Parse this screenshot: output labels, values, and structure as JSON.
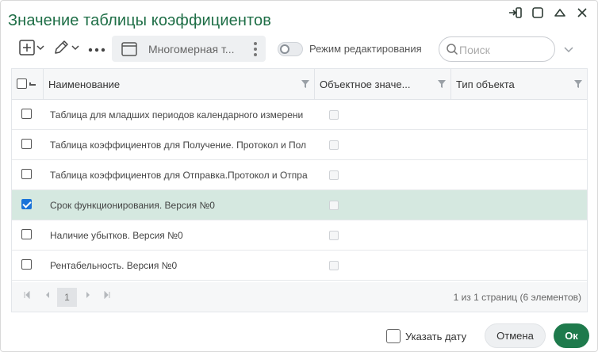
{
  "dialog": {
    "title": "Значение таблицы коэффициентов"
  },
  "window_controls": [
    "exit-icon",
    "maximize-icon",
    "collapse-icon",
    "close-icon"
  ],
  "toolbar": {
    "add_icon": "add-box-icon",
    "edit_icon": "pencil-icon",
    "more_icon": "ellipsis-icon",
    "view_label": "Многомерная т...",
    "edit_mode_label": "Режим редактирования",
    "edit_mode_on": false,
    "search_placeholder": "Поиск"
  },
  "grid": {
    "columns": [
      "Наименование",
      "Объектное значе...",
      "Тип объекта"
    ],
    "rows": [
      {
        "name": "Таблица для младших периодов календарного измерени",
        "checked": false
      },
      {
        "name": "Таблица коэффициентов для Получение. Протокол и Пол",
        "checked": false
      },
      {
        "name": "Таблица коэффициентов для Отправка.Протокол и Отпра",
        "checked": false
      },
      {
        "name": "Срок функционирования. Версия №0",
        "checked": true
      },
      {
        "name": "Наличие убытков. Версия №0",
        "checked": false
      },
      {
        "name": "Рентабельность. Версия №0",
        "checked": false
      }
    ],
    "selected_row_index": 3
  },
  "pager": {
    "current_page": "1",
    "info": "1 из 1 страниц (6 элементов)"
  },
  "footer": {
    "date_label": "Указать дату",
    "cancel_label": "Отмена",
    "ok_label": "Ок"
  },
  "colors": {
    "accent": "#1e7a4c",
    "title": "#1e6e46",
    "selected_row": "#d5e8e0",
    "checkbox_checked": "#1a73d9"
  }
}
